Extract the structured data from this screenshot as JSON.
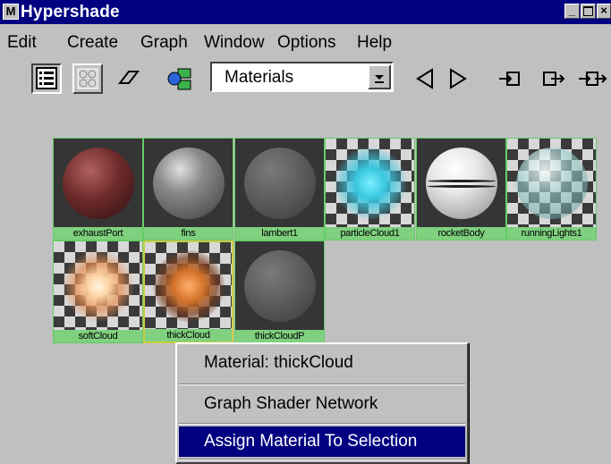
{
  "window": {
    "title": "Hypershade"
  },
  "menu": [
    "Edit",
    "Create",
    "Graph",
    "Window",
    "Options",
    "Help"
  ],
  "toolbar": {
    "filter_value": "Materials",
    "buttons": [
      "list-view-icon",
      "swatch-view-icon",
      "eraser-icon",
      "shader-graph-icon",
      "previous-icon",
      "next-icon",
      "input-connections-icon",
      "output-connections-icon",
      "input-output-connections-icon"
    ]
  },
  "swatches": [
    {
      "label": "exhaustPort",
      "bg": "solid",
      "color": "#6e2a2a"
    },
    {
      "label": "fins",
      "bg": "solid",
      "color": "#8a8a8a"
    },
    {
      "label": "lambert1",
      "bg": "solid",
      "color": "#5a5a5a"
    },
    {
      "label": "particleCloud1",
      "bg": "checker",
      "color": "#39c6e0"
    },
    {
      "label": "rocketBody",
      "bg": "solid",
      "color": "#e8e8e8"
    },
    {
      "label": "runningLights1",
      "bg": "checker",
      "color": "#9ad0d0"
    },
    {
      "label": "softCloud",
      "bg": "checker",
      "color": "#ffd7a8"
    },
    {
      "label": "thickCloud",
      "bg": "checker",
      "color": "#d4732a"
    },
    {
      "label": "thickCloudP",
      "bg": "solid",
      "color": "#5a5a5a"
    }
  ],
  "context_menu": {
    "header": "Material: thickCloud",
    "items": [
      "Graph Shader Network",
      "Assign Material To Selection"
    ],
    "highlighted": "Assign Material To Selection"
  }
}
